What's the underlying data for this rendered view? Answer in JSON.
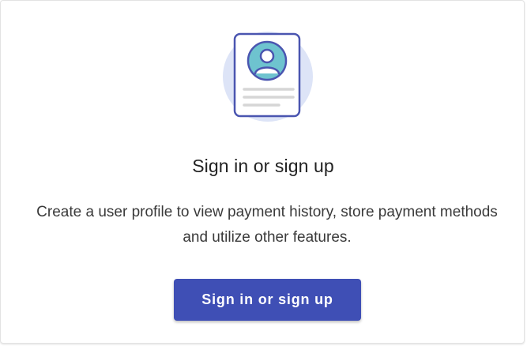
{
  "prompt": {
    "title": "Sign in or sign up",
    "description": "Create a user profile to view payment history, store payment methods and utilize other features.",
    "button_label": "Sign in or sign up"
  },
  "illustration": {
    "icon": "user-profile-document-icon"
  },
  "colors": {
    "accent": "#3f4fb5",
    "avatar_teal": "#6ec3cf",
    "halo": "#dde4f7",
    "outline": "#4a55b0"
  }
}
